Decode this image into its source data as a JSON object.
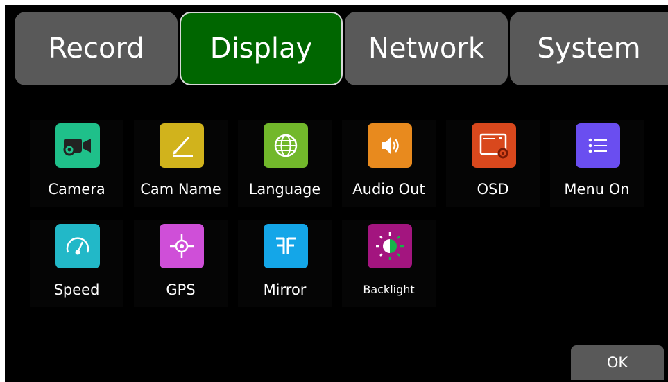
{
  "tabs": [
    {
      "label": "Record"
    },
    {
      "label": "Display",
      "active": true
    },
    {
      "label": "Network"
    },
    {
      "label": "System"
    }
  ],
  "items": [
    {
      "label": "Camera",
      "icon": "camera-gear-icon",
      "color": "#1fc08a"
    },
    {
      "label": "Cam Name",
      "icon": "pencil-icon",
      "color": "#d1b31c"
    },
    {
      "label": "Language",
      "icon": "globe-icon",
      "color": "#72b82b"
    },
    {
      "label": "Audio Out",
      "icon": "speaker-icon",
      "color": "#e88a1e"
    },
    {
      "label": "OSD",
      "icon": "screen-gear-icon",
      "color": "#d9481d"
    },
    {
      "label": "Menu On",
      "icon": "list-icon",
      "color": "#6a4ef0"
    },
    {
      "label": "Speed",
      "icon": "speedometer-icon",
      "color": "#22b8c8"
    },
    {
      "label": "GPS",
      "icon": "crosshair-icon",
      "color": "#cf4fd8"
    },
    {
      "label": "Mirror",
      "icon": "mirror-f-icon",
      "color": "#14a6e8"
    },
    {
      "label": "Backlight",
      "icon": "brightness-icon",
      "color": "#a3157f"
    }
  ],
  "ok_button": {
    "label": "OK"
  },
  "colors": {
    "background": "#000000",
    "tab": "#595959",
    "tab_active": "#006600",
    "text": "#ffffff"
  }
}
